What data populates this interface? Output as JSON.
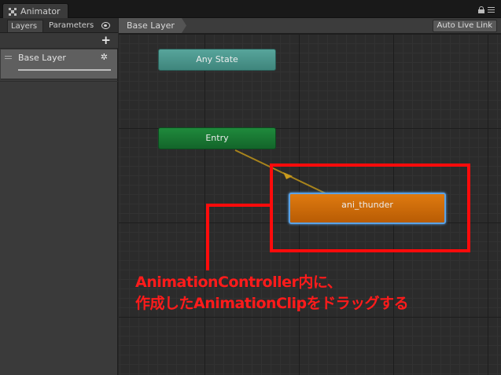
{
  "window": {
    "tab_title": "Animator"
  },
  "left_panel": {
    "tabs": [
      {
        "label": "Layers"
      },
      {
        "label": "Parameters"
      }
    ],
    "add_button": "+",
    "layers": [
      {
        "name": "Base Layer",
        "gear": "✲"
      }
    ]
  },
  "toolbar": {
    "breadcrumb": "Base Layer",
    "auto_live_link": "Auto Live Link"
  },
  "graph": {
    "nodes": [
      {
        "label": "Any State",
        "color": "#4c978e"
      },
      {
        "label": "Entry",
        "color": "#187a34"
      },
      {
        "label": "ani_thunder",
        "color": "#cc6a08",
        "selected_outline": "#5aa2e6"
      }
    ],
    "transition_color": "#a8841c"
  },
  "annotation": {
    "line1": "AnimationController内に、",
    "line2": "作成したAnimationClipをドラッグする",
    "color": "#ff0b0b"
  }
}
